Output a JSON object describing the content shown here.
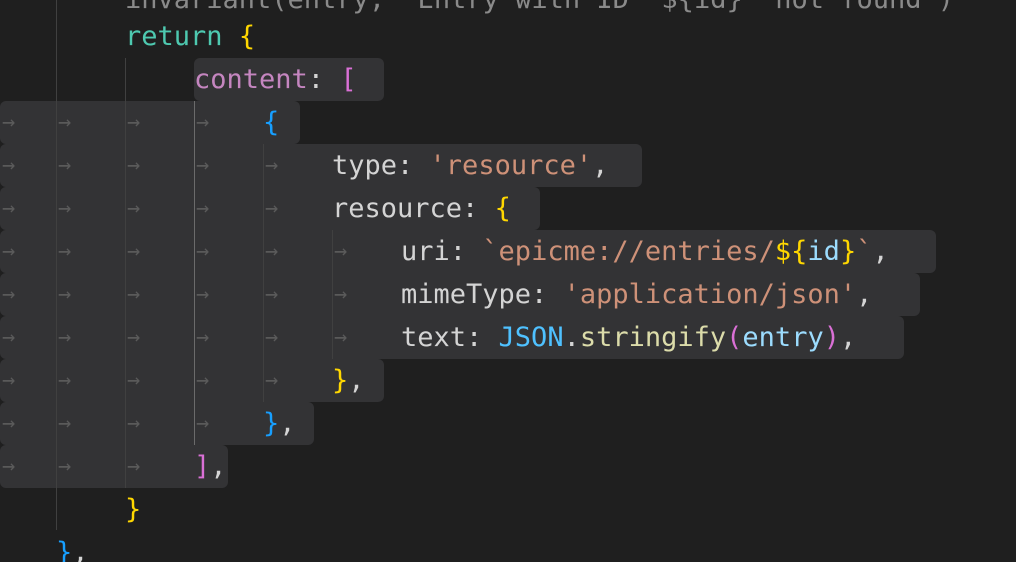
{
  "editor": {
    "lines": [
      {
        "id": "l0",
        "tokens": [
          {
            "t": "invariant(entry, `Entry with ID \"${id}\" not found`)",
            "c": "dim"
          }
        ]
      },
      {
        "id": "l1",
        "tokens": [
          {
            "t": "return",
            "c": "ctrl"
          },
          {
            "t": " ",
            "c": "pnc"
          },
          {
            "t": "{",
            "c": "br1"
          }
        ]
      },
      {
        "id": "l2",
        "tokens": [
          {
            "t": "content",
            "c": "prop2"
          },
          {
            "t": ": ",
            "c": "pnc"
          },
          {
            "t": "[",
            "c": "br2"
          }
        ]
      },
      {
        "id": "l3",
        "tokens": [
          {
            "t": "{",
            "c": "br3"
          }
        ]
      },
      {
        "id": "l4",
        "tokens": [
          {
            "t": "type",
            "c": "prop"
          },
          {
            "t": ": ",
            "c": "pnc"
          },
          {
            "t": "'resource'",
            "c": "str"
          },
          {
            "t": ",",
            "c": "pnc"
          }
        ]
      },
      {
        "id": "l5",
        "tokens": [
          {
            "t": "resource",
            "c": "prop"
          },
          {
            "t": ": ",
            "c": "pnc"
          },
          {
            "t": "{",
            "c": "br1"
          }
        ]
      },
      {
        "id": "l6",
        "tokens": [
          {
            "t": "uri",
            "c": "prop"
          },
          {
            "t": ": ",
            "c": "pnc"
          },
          {
            "t": "`epicme://entries/",
            "c": "tpl"
          },
          {
            "t": "${",
            "c": "br1"
          },
          {
            "t": "id",
            "c": "tvar"
          },
          {
            "t": "}",
            "c": "br1"
          },
          {
            "t": "`",
            "c": "tpl"
          },
          {
            "t": ",",
            "c": "pnc"
          }
        ]
      },
      {
        "id": "l7",
        "tokens": [
          {
            "t": "mimeType",
            "c": "prop"
          },
          {
            "t": ": ",
            "c": "pnc"
          },
          {
            "t": "'application/json'",
            "c": "str"
          },
          {
            "t": ",",
            "c": "pnc"
          }
        ]
      },
      {
        "id": "l8",
        "tokens": [
          {
            "t": "text",
            "c": "prop"
          },
          {
            "t": ": ",
            "c": "pnc"
          },
          {
            "t": "JSON",
            "c": "ident"
          },
          {
            "t": ".",
            "c": "pnc"
          },
          {
            "t": "stringify",
            "c": "fn"
          },
          {
            "t": "(",
            "c": "br2"
          },
          {
            "t": "entry",
            "c": "var"
          },
          {
            "t": ")",
            "c": "br2"
          },
          {
            "t": ",",
            "c": "pnc"
          }
        ]
      },
      {
        "id": "l9",
        "tokens": [
          {
            "t": "}",
            "c": "br1"
          },
          {
            "t": ",",
            "c": "pnc"
          }
        ]
      },
      {
        "id": "l10",
        "tokens": [
          {
            "t": "}",
            "c": "br3"
          },
          {
            "t": ",",
            "c": "pnc"
          }
        ]
      },
      {
        "id": "l11",
        "tokens": [
          {
            "t": "]",
            "c": "br2"
          },
          {
            "t": ",",
            "c": "pnc"
          }
        ]
      },
      {
        "id": "l12",
        "tokens": [
          {
            "t": "}",
            "c": "br1"
          }
        ]
      },
      {
        "id": "l13",
        "tokens": [
          {
            "t": "}",
            "c": "br3"
          },
          {
            "t": ",",
            "c": "pnc"
          }
        ]
      }
    ],
    "whitespace_glyph": "→"
  }
}
